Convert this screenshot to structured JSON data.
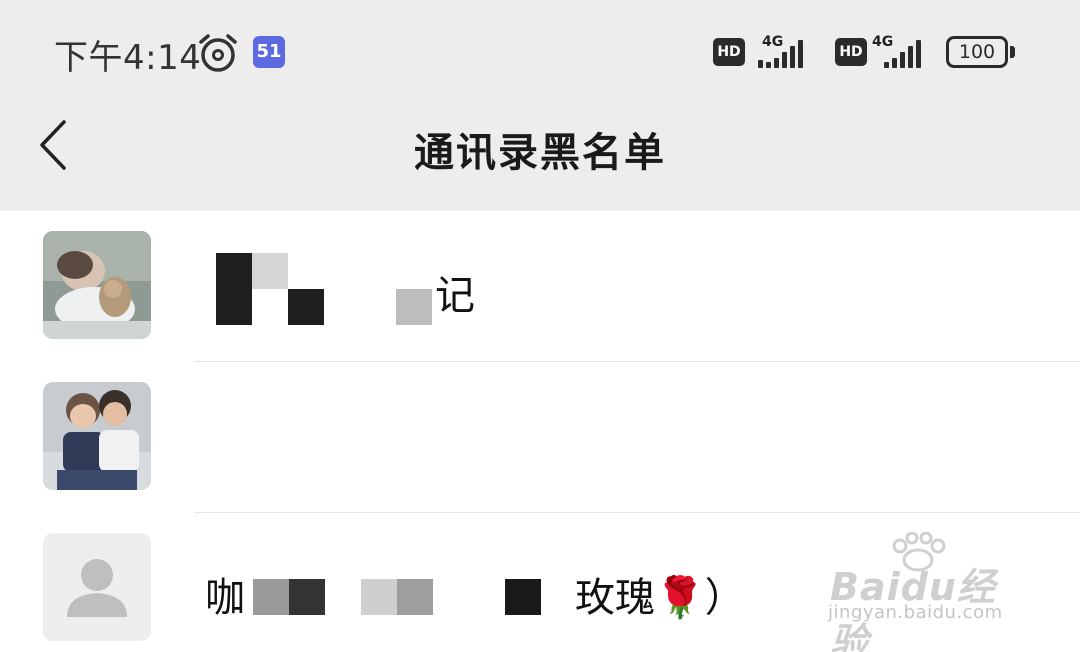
{
  "status_bar": {
    "time": "下午4:14",
    "app_icon_glyph": "51",
    "sim1": {
      "hd": "HD",
      "network": "4G"
    },
    "sim2": {
      "hd": "HD",
      "network": "4G"
    },
    "battery_level": "100",
    "icons": [
      "alarm-clock-icon",
      "app-notification-icon",
      "signal-icon",
      "battery-icon"
    ]
  },
  "nav": {
    "title": "通讯录黑名单",
    "back_icon": "chevron-left-icon"
  },
  "blacklist": [
    {
      "name_visible": "记",
      "avatar": "photo-child-with-plush"
    },
    {
      "name_visible": "",
      "avatar": "photo-two-kids"
    },
    {
      "name_start": "咖",
      "name_end": "玫瑰🌹）",
      "avatar": "default-person-icon"
    }
  ],
  "watermark": {
    "brand": "Baidu经验",
    "url": "jingyan.baidu.com"
  },
  "colors": {
    "header_bg": "#ededed",
    "list_bg": "#ffffff",
    "divider": "#e5e5e5",
    "app_icon": "#5b6ae0"
  }
}
